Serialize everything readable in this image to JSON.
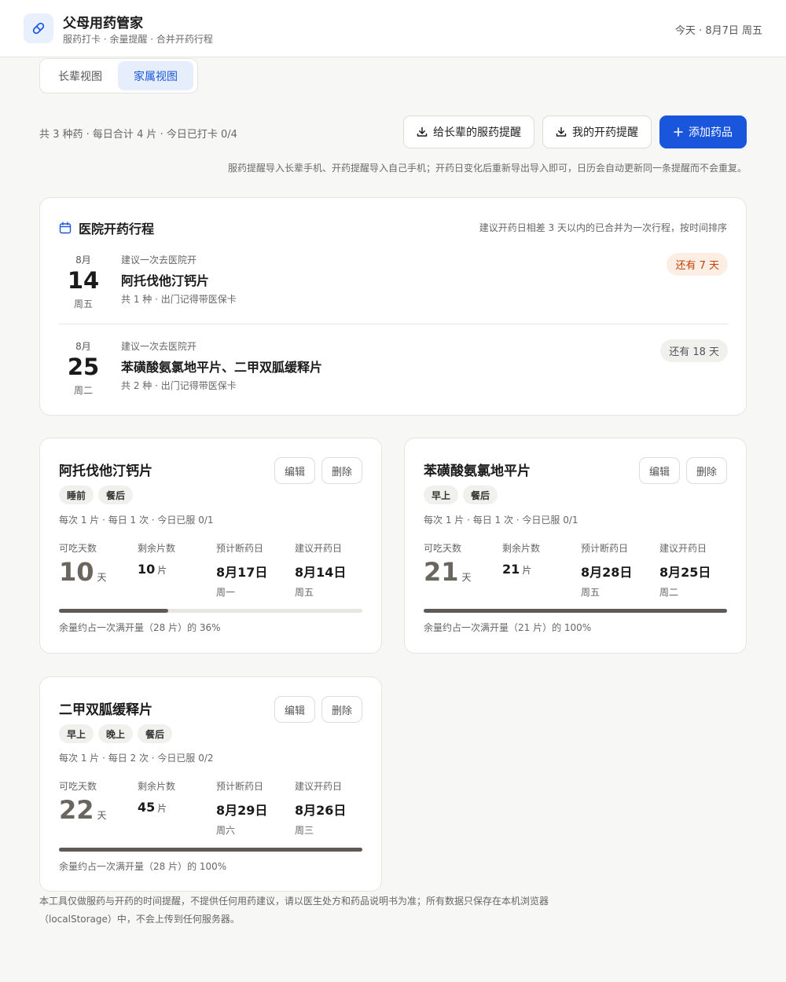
{
  "header": {
    "title": "父母用药管家",
    "subtitle": "服药打卡 · 余量提醒 · 合并开药行程",
    "today": "今天 · 8月7日 周五",
    "logo_icon": "pill-icon",
    "accent": "#1a56db"
  },
  "views": [
    {
      "label": "长辈视图",
      "active": false
    },
    {
      "label": "家属视图",
      "active": true
    }
  ],
  "summary": "共 3 种药 · 每日合计 4 片 · 今日已打卡 0/4",
  "actions": {
    "elder_reminder": "给长辈的服药提醒",
    "my_reminder": "我的开药提醒",
    "add_drug": "添加药品"
  },
  "hint": "服药提醒导入长辈手机、开药提醒导入自己手机；开药日变化后重新导出导入即可，日历会自动更新同一条提醒而不会重复。",
  "schedule": {
    "title": "医院开药行程",
    "note": "建议开药日相差 3 天以内的已合并为一次行程，按时间排序",
    "trips": [
      {
        "month": "8月",
        "day": "14",
        "weekday": "周五",
        "hint": "建议一次去医院开",
        "drugs": "阿托伐他汀钙片",
        "meta": "共 1 种 · 出门记得带医保卡",
        "badge": "还有 7 天",
        "urgent": true
      },
      {
        "month": "8月",
        "day": "25",
        "weekday": "周二",
        "hint": "建议一次去医院开",
        "drugs": "苯磺酸氨氯地平片、二甲双胍缓释片",
        "meta": "共 2 种 · 出门记得带医保卡",
        "badge": "还有 18 天",
        "urgent": false
      }
    ]
  },
  "labels": {
    "edit": "编辑",
    "delete": "删除",
    "days_left": "可吃天数",
    "pills_left": "剩余片数",
    "run_out": "预计断药日",
    "refill_date": "建议开药日",
    "day_unit": "天",
    "pill_unit": "片"
  },
  "medicines": [
    {
      "name": "阿托伐他汀钙片",
      "tags": [
        "睡前",
        "餐后"
      ],
      "dose": "每次 1 片 · 每日 1 次 · 今日已服 0/1",
      "days": "10",
      "pills": "10",
      "run_out": "8月17日",
      "run_out_week": "周一",
      "refill": "8月14日",
      "refill_week": "周五",
      "level": 0.36,
      "bar_note": "余量约占一次满开量（28 片）的 36%"
    },
    {
      "name": "苯磺酸氨氯地平片",
      "tags": [
        "早上",
        "餐后"
      ],
      "dose": "每次 1 片 · 每日 1 次 · 今日已服 0/1",
      "days": "21",
      "pills": "21",
      "run_out": "8月28日",
      "run_out_week": "周五",
      "refill": "8月25日",
      "refill_week": "周二",
      "level": 1.0,
      "bar_note": "余量约占一次满开量（21 片）的 100%"
    },
    {
      "name": "二甲双胍缓释片",
      "tags": [
        "早上",
        "晚上",
        "餐后"
      ],
      "dose": "每次 1 片 · 每日 2 次 · 今日已服 0/2",
      "days": "22",
      "pills": "45",
      "run_out": "8月29日",
      "run_out_week": "周六",
      "refill": "8月26日",
      "refill_week": "周三",
      "level": 1.0,
      "bar_note": "余量约占一次满开量（28 片）的 100%"
    }
  ],
  "footer": "本工具仅做服药与开药的时间提醒，不提供任何用药建议，请以医生处方和药品说明书为准；所有数据只保存在本机浏览器（localStorage）中，不会上传到任何服务器。"
}
